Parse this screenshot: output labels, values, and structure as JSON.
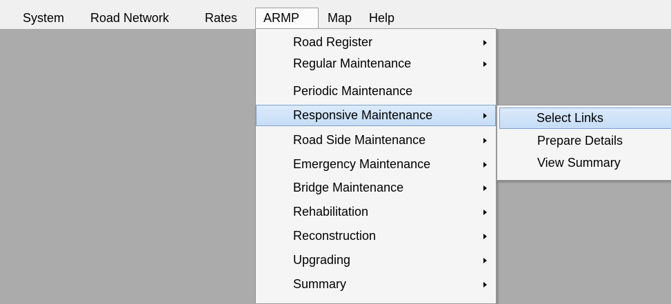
{
  "menubar": {
    "items": [
      {
        "label": "System"
      },
      {
        "label": "Road Network"
      },
      {
        "label": "Rates"
      },
      {
        "label": "ARMP"
      },
      {
        "label": "Map"
      },
      {
        "label": "Help"
      }
    ]
  },
  "armp_menu": {
    "items": [
      {
        "label": "Road Register",
        "submenu_arrow": true
      },
      {
        "label": "Regular Maintenance",
        "submenu_arrow": true
      },
      {
        "label": "Periodic Maintenance",
        "submenu_arrow": false
      },
      {
        "label": "Responsive Maintenance",
        "submenu_arrow": true,
        "highlighted": true
      },
      {
        "label": "Road Side Maintenance",
        "submenu_arrow": true
      },
      {
        "label": "Emergency Maintenance",
        "submenu_arrow": true
      },
      {
        "label": "Bridge Maintenance",
        "submenu_arrow": true
      },
      {
        "label": "Rehabilitation",
        "submenu_arrow": true
      },
      {
        "label": "Reconstruction",
        "submenu_arrow": true
      },
      {
        "label": "Upgrading",
        "submenu_arrow": true
      },
      {
        "label": "Summary",
        "submenu_arrow": true
      }
    ]
  },
  "responsive_submenu": {
    "items": [
      {
        "label": "Select Links",
        "highlighted": true
      },
      {
        "label": "Prepare Details"
      },
      {
        "label": "View Summary"
      }
    ]
  },
  "colors": {
    "workspace": "#ababab",
    "menu_background": "#f5f5f5",
    "highlight": "#c6ddf7",
    "highlight_border": "#7da2ce"
  }
}
